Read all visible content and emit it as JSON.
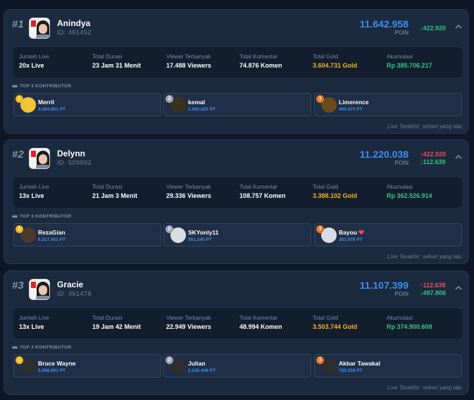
{
  "cards": [
    {
      "rank": "#1",
      "name": "Anindya",
      "id": "ID: 461452",
      "points": "11.642.958",
      "points_label": "POIN",
      "delta_up": "",
      "delta_down": "↓422.920",
      "stats": {
        "jumlah_live_label": "Jumlah Live",
        "jumlah_live": "20x Live",
        "durasi_label": "Total Durasi",
        "durasi": "23 Jam 31 Menit",
        "viewer_label": "Viewer Terbanyak",
        "viewer": "17.488 Viewers",
        "komentar_label": "Total Komentar",
        "komentar": "74.876 Komen",
        "gold_label": "Total Gold",
        "gold": "3.604.731 Gold",
        "akumulasi_label": "Akumulasi",
        "akumulasi": "Rp 385.706.217"
      },
      "top3_label": "TOP 3 KONTRIBUTOR",
      "contributors": [
        {
          "name": "Merril",
          "points": "4.594.851 PT",
          "rank": "1"
        },
        {
          "name": "kemal",
          "points": "1.865.825 PT",
          "rank": "2"
        },
        {
          "name": "Limerence",
          "points": "400.973 PT",
          "rank": "3"
        }
      ],
      "last_live": "Live Terakhir: sehari yang lalu"
    },
    {
      "rank": "#2",
      "name": "Delynn",
      "id": "ID: 509992",
      "points": "11.220.038",
      "points_label": "POIN",
      "delta_up": "↑422.920",
      "delta_down": "↓112.639",
      "stats": {
        "jumlah_live_label": "Jumlah Live",
        "jumlah_live": "13x Live",
        "durasi_label": "Total Durasi",
        "durasi": "21 Jam 3 Menit",
        "viewer_label": "Viewer Terbanyak",
        "viewer": "29.336 Viewers",
        "komentar_label": "Total Komentar",
        "komentar": "108.757 Komen",
        "gold_label": "Total Gold",
        "gold": "3.388.102 Gold",
        "akumulasi_label": "Akumulasi",
        "akumulasi": "Rp 362.526.914"
      },
      "top3_label": "TOP 3 KONTRIBUTOR",
      "contributors": [
        {
          "name": "RezaGian",
          "points": "6.317.902 PT",
          "rank": "1"
        },
        {
          "name": "SKYonly11",
          "points": "561.240 PT",
          "rank": "2"
        },
        {
          "name": "Bayou",
          "points": "263.976 PT",
          "rank": "3"
        }
      ],
      "last_live": "Live Terakhir: sehari yang lalu"
    },
    {
      "rank": "#3",
      "name": "Gracie",
      "id": "ID: 461478",
      "points": "11.107.399",
      "points_label": "POIN",
      "delta_up": "↑112.639",
      "delta_down": "↓497.806",
      "stats": {
        "jumlah_live_label": "Jumlah Live",
        "jumlah_live": "13x Live",
        "durasi_label": "Total Durasi",
        "durasi": "19 Jam 42 Menit",
        "viewer_label": "Viewer Terbanyak",
        "viewer": "22.949 Viewers",
        "komentar_label": "Total Komentar",
        "komentar": "48.994 Komen",
        "gold_label": "Total Gold",
        "gold": "3.503.744 Gold",
        "akumulasi_label": "Akumulasi",
        "akumulasi": "Rp 374.900.608"
      },
      "top3_label": "TOP 3 KONTRIBUTOR",
      "contributors": [
        {
          "name": "Bruce Wayne",
          "points": "5.598.991 PT",
          "rank": "1"
        },
        {
          "name": "Julian",
          "points": "2.235.448 PT",
          "rank": "2"
        },
        {
          "name": "Akbar Tawakal",
          "points": "755.526 PT",
          "rank": "3"
        }
      ],
      "last_live": "Live Terakhir: sehari yang lalu"
    }
  ],
  "colors": {
    "accent_blue": "#3b8ff0",
    "gold": "#f2b02c",
    "green": "#35c47e",
    "red": "#ef4c54"
  }
}
